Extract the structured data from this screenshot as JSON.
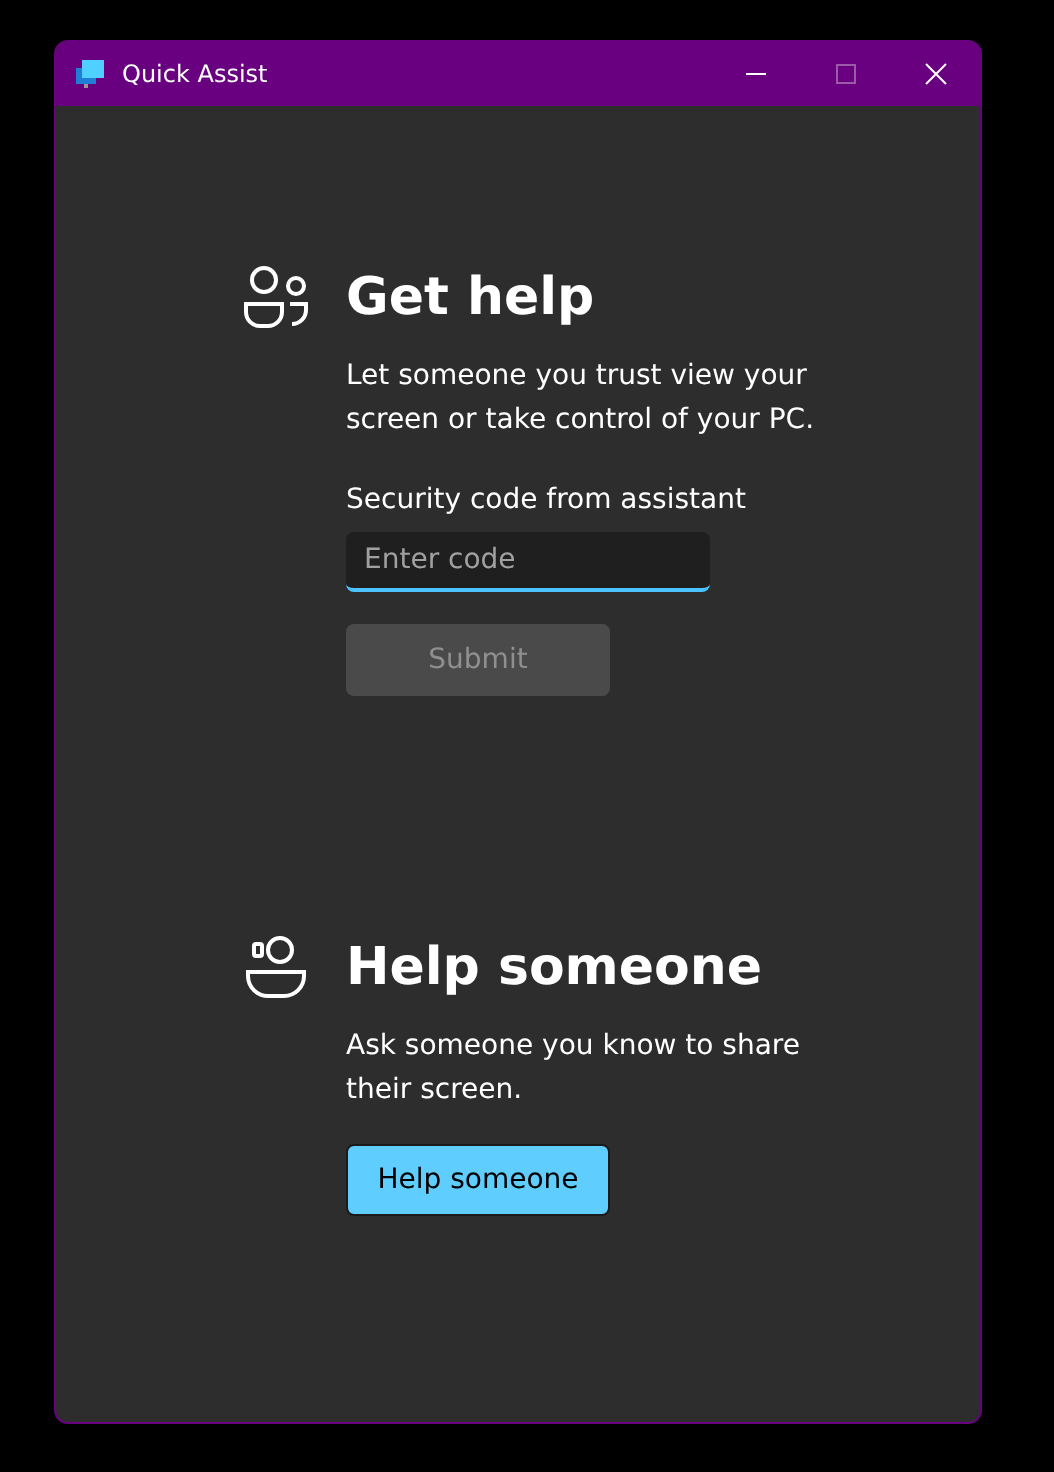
{
  "window": {
    "title": "Quick Assist"
  },
  "get_help": {
    "title": "Get help",
    "description": "Let someone you trust view your screen or take control of your PC.",
    "field_label": "Security code from assistant",
    "code_field": {
      "placeholder": "Enter code"
    },
    "submit": {
      "label": "Submit",
      "disabled": true
    }
  },
  "help_someone": {
    "title": "Help someone",
    "description": "Ask someone you know to share their screen.",
    "button": {
      "label": "Help someone",
      "disabled": false
    }
  }
}
